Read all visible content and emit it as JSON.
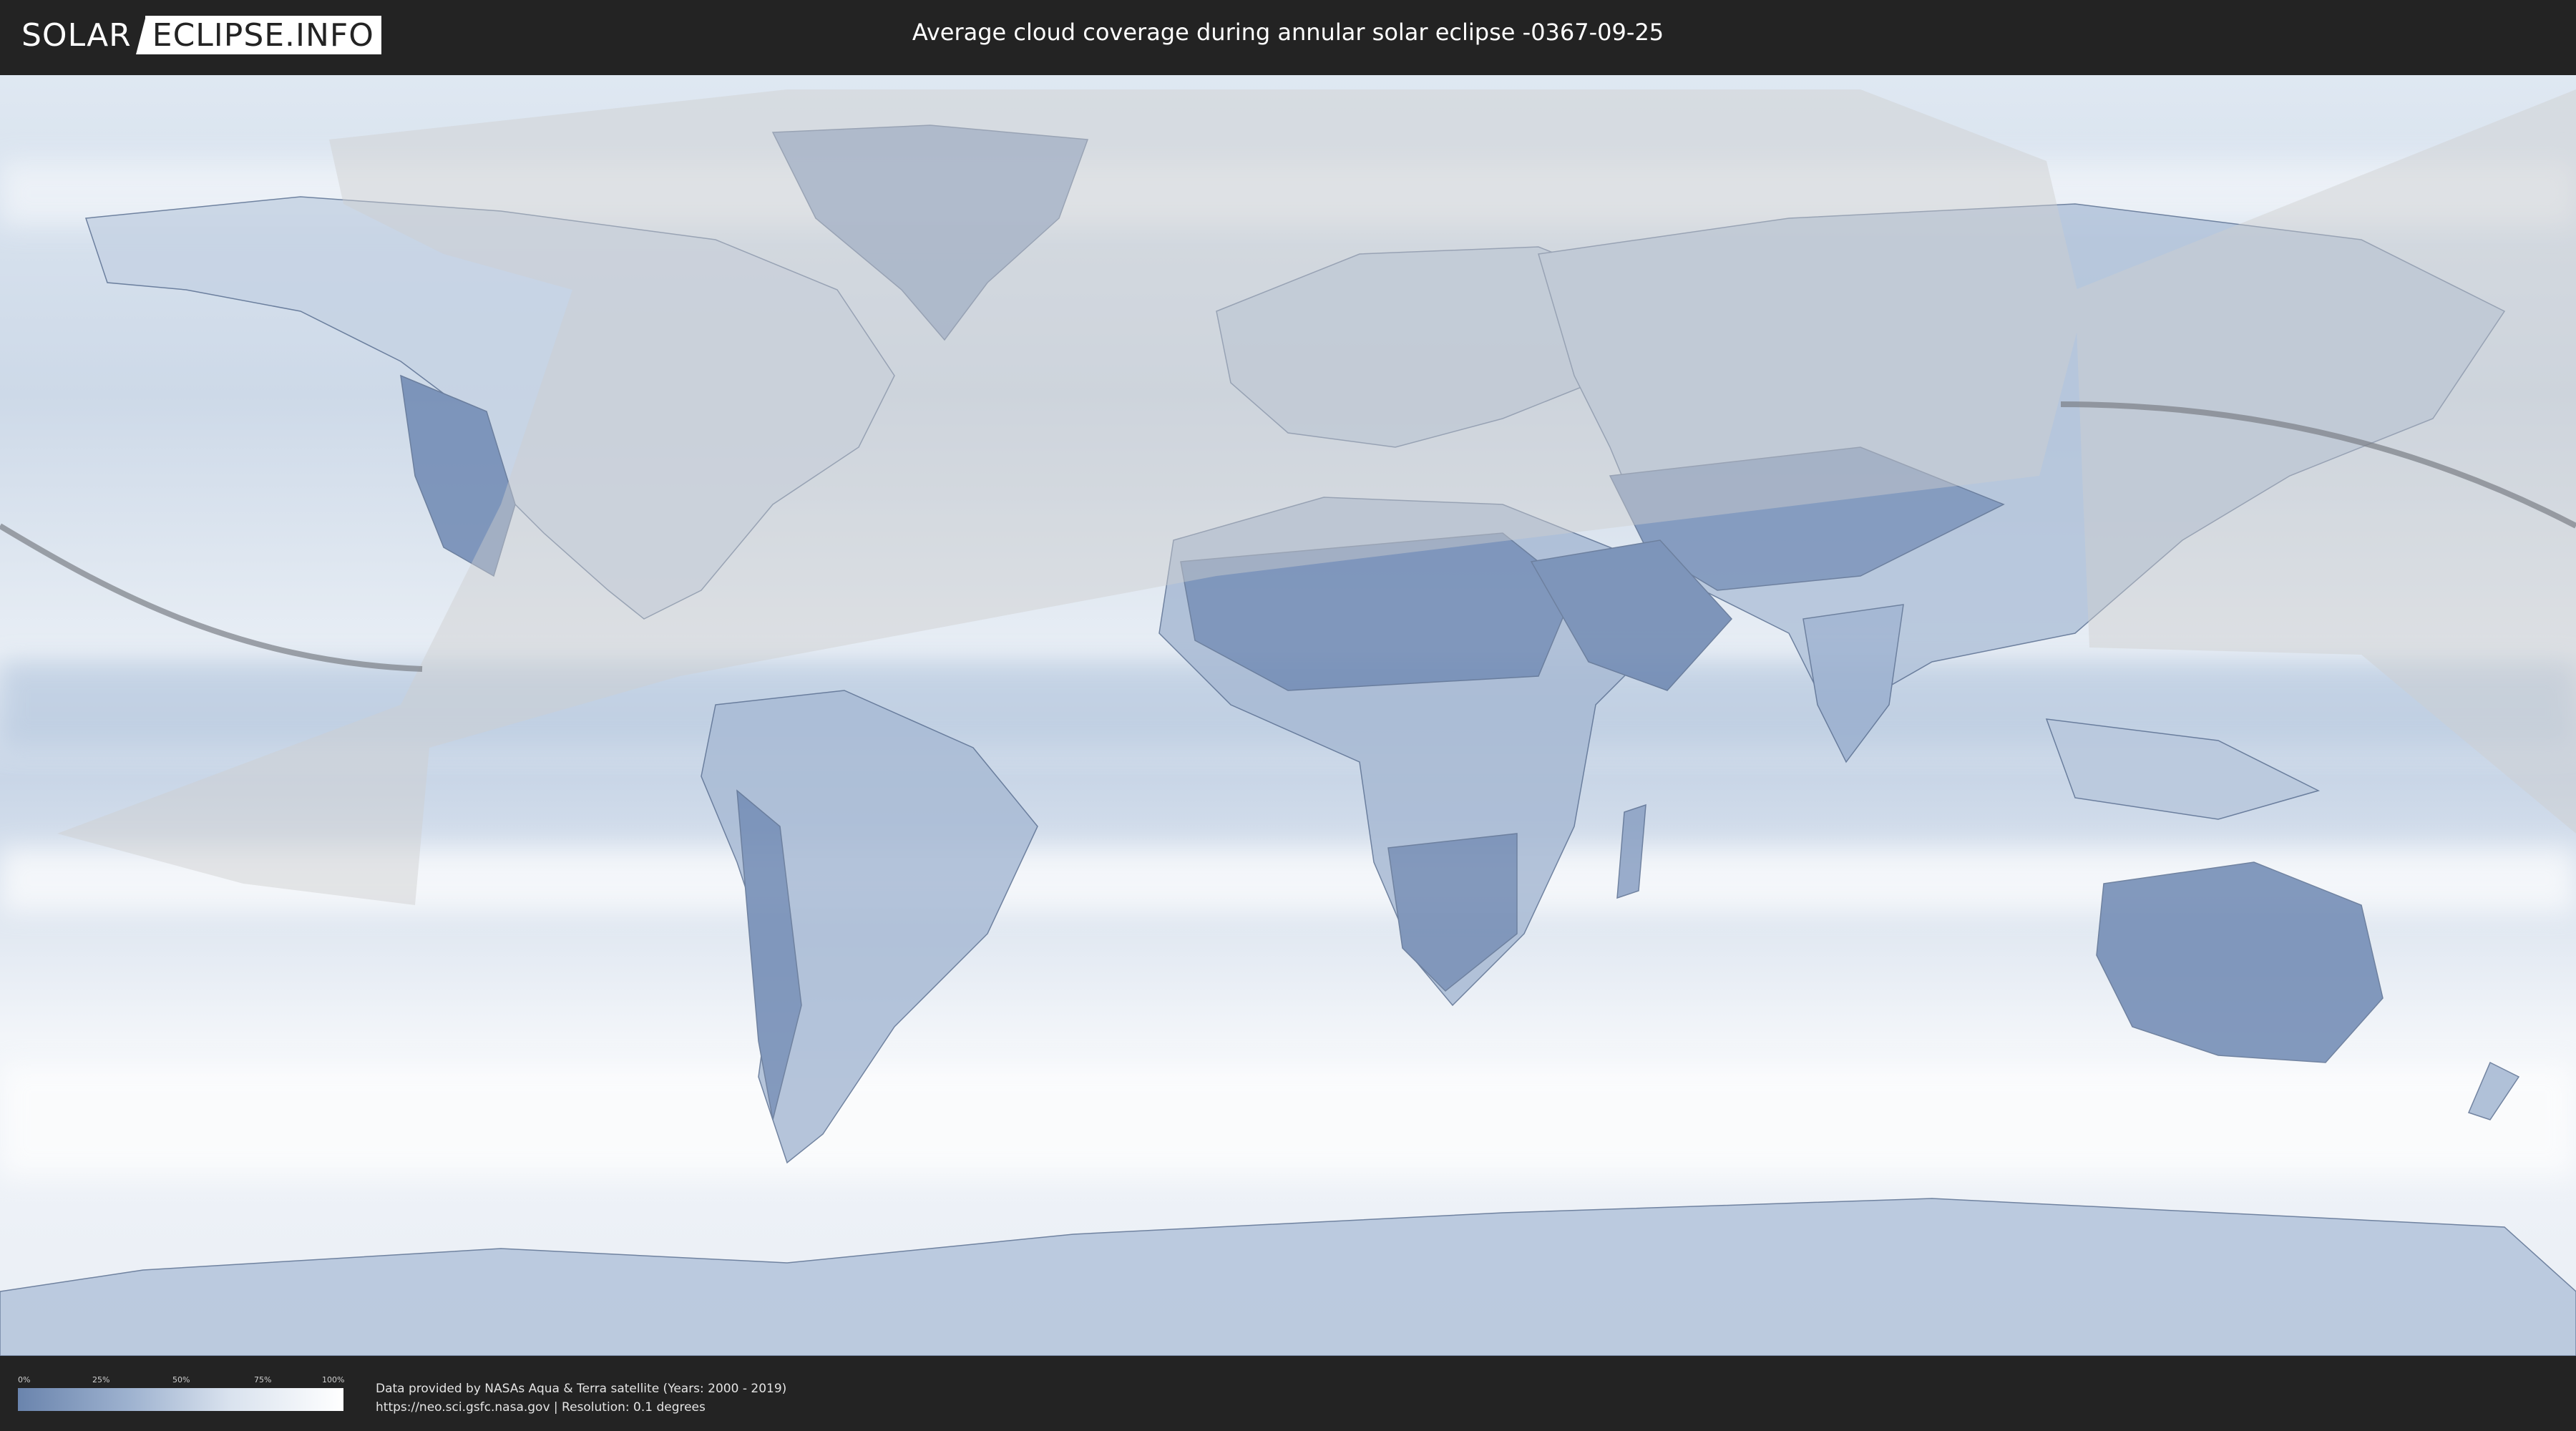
{
  "header": {
    "logo_left": "SOLAR",
    "logo_right": "ECLIPSE.INFO",
    "title": "Average cloud coverage during annular solar eclipse -0367-09-25"
  },
  "legend": {
    "ticks": [
      "0%",
      "25%",
      "50%",
      "75%",
      "100%"
    ],
    "gradient_colors": [
      "#6a84ad",
      "#9fb3d0",
      "#d9e2ee",
      "#ffffff"
    ]
  },
  "footer": {
    "credit_line1": "Data provided by NASAs Aqua & Terra satellite (Years: 2000 - 2019)",
    "credit_line2": "https://neo.sci.gsfc.nasa.gov | Resolution: 0.1 degrees"
  },
  "colors": {
    "background": "#232323",
    "ocean_clouds": "#e6edf5",
    "clear_land": "#6f89b3",
    "eclipse_overlay": "#cfcfcf",
    "path_line": "#7a7f86"
  },
  "icons": {
    "logo_mark": "eclipse-logo-icon"
  }
}
